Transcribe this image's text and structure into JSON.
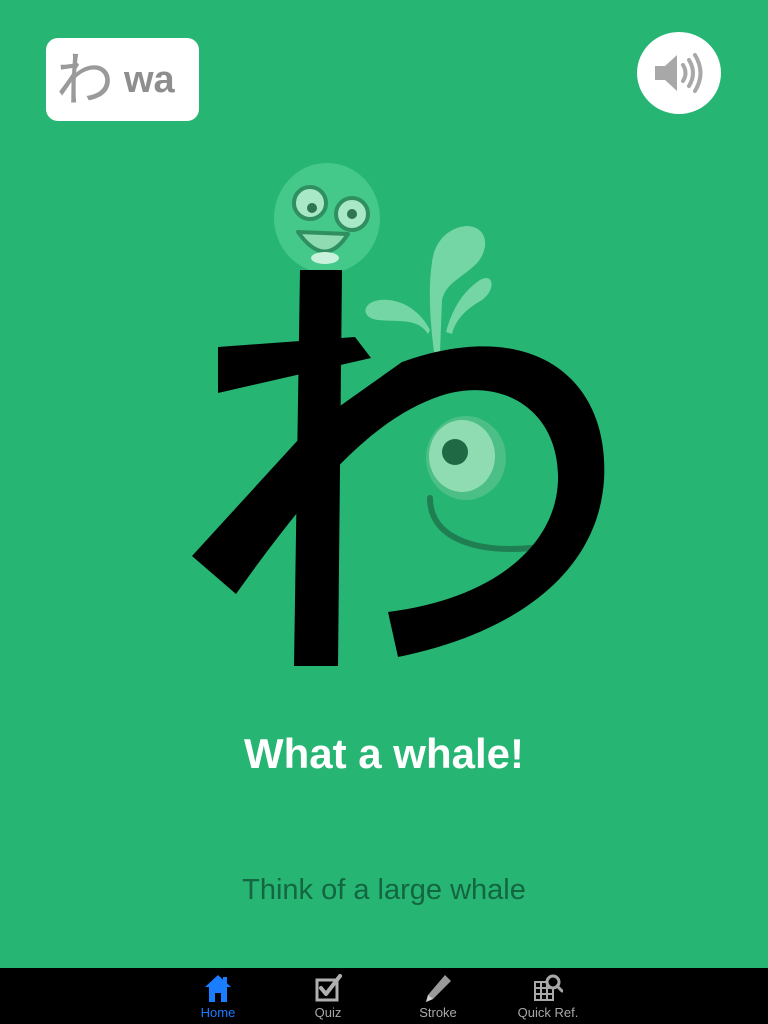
{
  "kana_card": {
    "kana": "わ",
    "romaji": "wa"
  },
  "sound_button": {
    "icon": "speaker-icon"
  },
  "mnemonic": {
    "title": "What a whale!",
    "description": "Think of a large whale"
  },
  "tab_bar": {
    "tabs": [
      {
        "label": "Home",
        "icon": "home-icon",
        "active": true
      },
      {
        "label": "Quiz",
        "icon": "checkbox-icon",
        "active": false
      },
      {
        "label": "Stroke",
        "icon": "pencil-icon",
        "active": false
      },
      {
        "label": "Quick Ref.",
        "icon": "grid-search-icon",
        "active": false
      }
    ]
  },
  "colors": {
    "background": "#26b573",
    "accent_light": "#45c98a",
    "active_tab": "#1a7cff",
    "inactive_tab": "#a8a8a8"
  }
}
